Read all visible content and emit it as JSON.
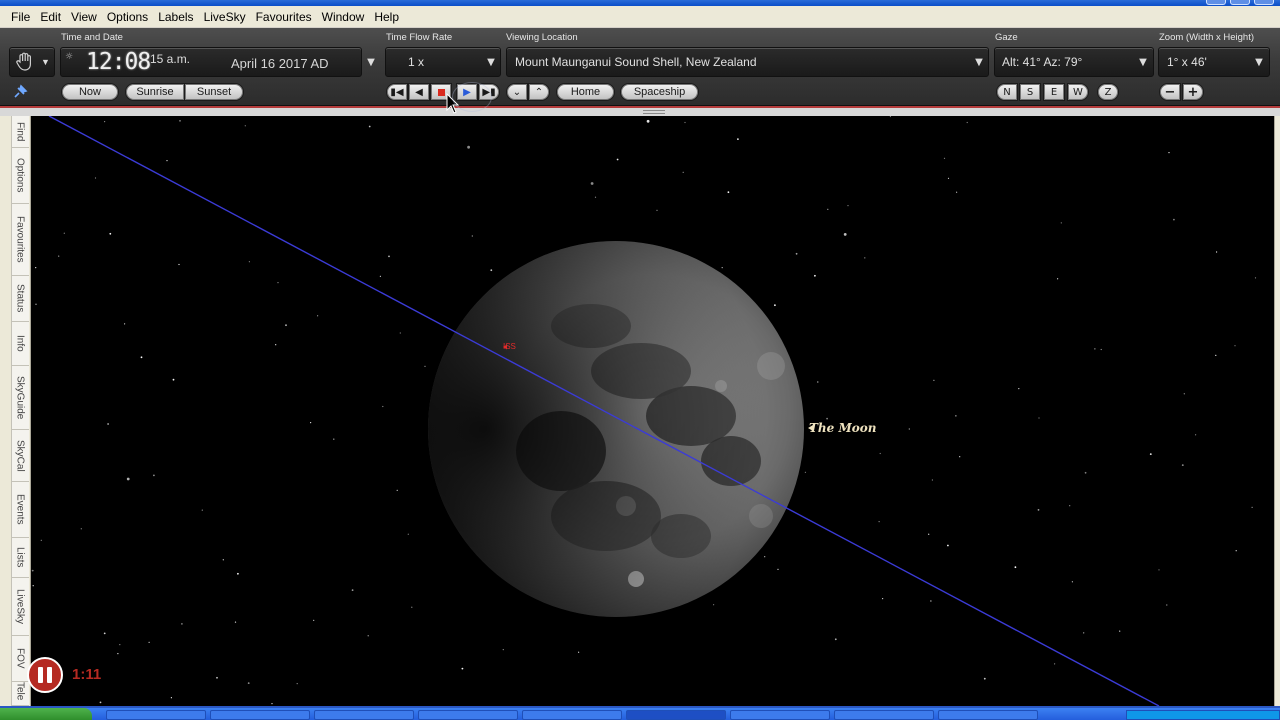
{
  "menu": [
    "File",
    "Edit",
    "View",
    "Options",
    "Labels",
    "LiveSky",
    "Favourites",
    "Window",
    "Help"
  ],
  "toolbar": {
    "time_date_label": "Time and Date",
    "clock_digits": "12:08",
    "clock_seconds": "15 a.m.",
    "date_text": "April 16   2017 AD",
    "now_button": "Now",
    "sunrise_button": "Sunrise",
    "sunset_button": "Sunset",
    "time_flow_label": "Time Flow Rate",
    "time_flow_value": "1 x",
    "viewing_location_label": "Viewing Location",
    "viewing_location_value": "Mount Maunganui Sound Shell, New Zealand",
    "home_button": "Home",
    "spaceship_button": "Spaceship",
    "gaze_label": "Gaze",
    "gaze_value": "Alt: 41° Az: 79°",
    "compass": [
      "N",
      "S",
      "E",
      "W",
      "Z"
    ],
    "zoom_label": "Zoom (Width x Height)",
    "zoom_value": "1° x 46'"
  },
  "sidebar_tabs": [
    "Find",
    "Options",
    "Favourites",
    "Status",
    "Info",
    "SkyGuide",
    "SkyCal",
    "Events",
    "Lists",
    "LiveSky",
    "FOV",
    "Tele"
  ],
  "sky": {
    "moon_label": "The Moon",
    "iss_label": "ISS"
  },
  "overlay": {
    "video_time": "1:11"
  },
  "colors": {
    "orbit_line": "#3b3bd6",
    "iss_label": "#e22a2a",
    "moon_label": "#efe3bf",
    "record_button": "#d92a1f"
  }
}
